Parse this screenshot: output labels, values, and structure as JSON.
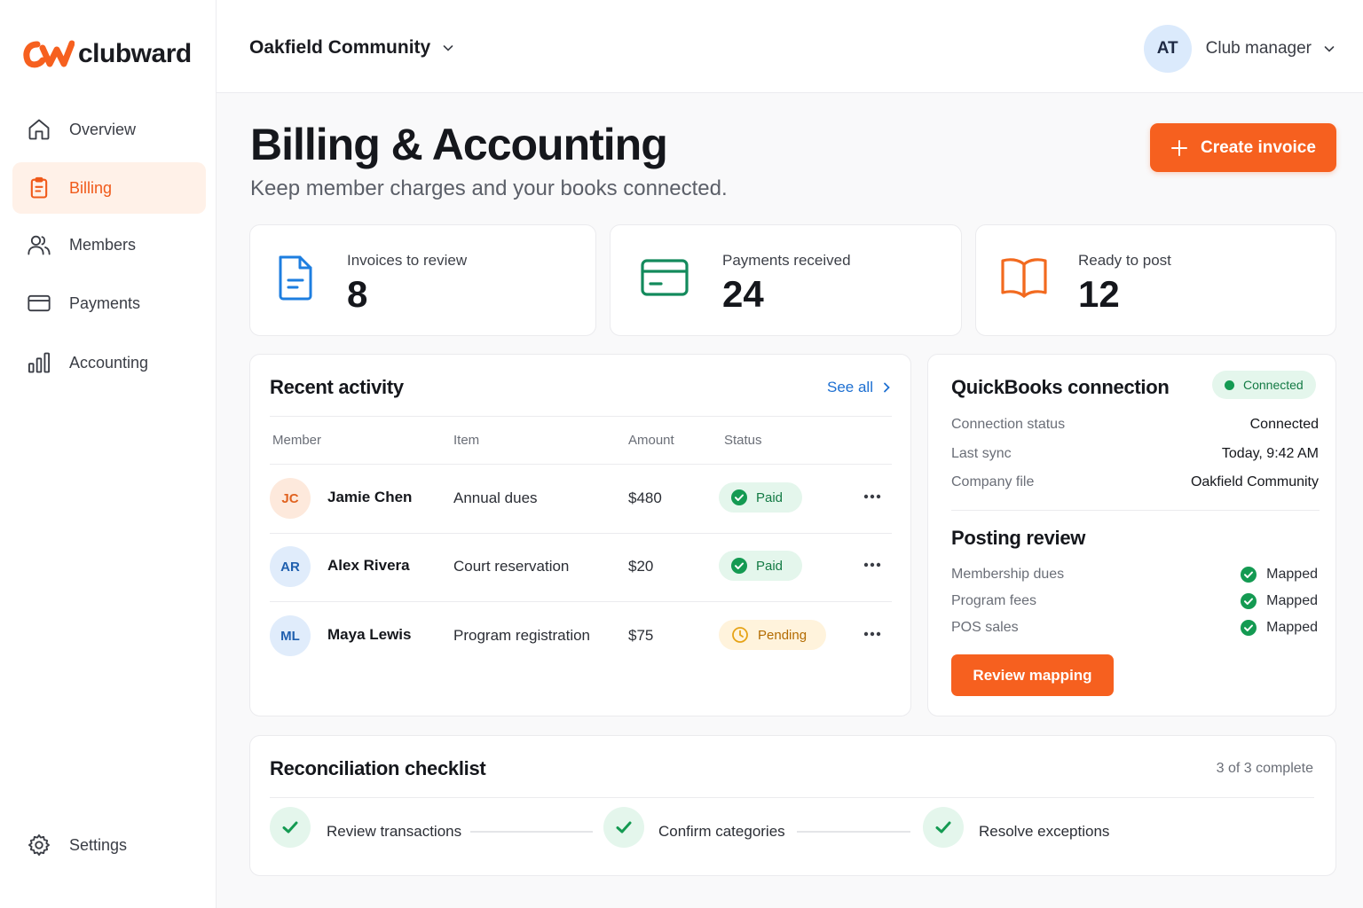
{
  "brand": {
    "name": "clubward",
    "accent": "#f6601f"
  },
  "sidebar": {
    "items": [
      {
        "label": "Overview",
        "icon": "home-icon"
      },
      {
        "label": "Billing",
        "icon": "clipboard-icon",
        "active": true
      },
      {
        "label": "Members",
        "icon": "users-icon"
      },
      {
        "label": "Payments",
        "icon": "credit-card-icon"
      },
      {
        "label": "Accounting",
        "icon": "bar-chart-icon"
      }
    ],
    "settings_label": "Settings"
  },
  "topbar": {
    "org_name": "Oakfield Community",
    "user_initials": "AT",
    "user_role": "Club manager"
  },
  "header": {
    "title": "Billing & Accounting",
    "subtitle": "Keep member charges and your books connected.",
    "create_label": "Create invoice"
  },
  "kpis": [
    {
      "label": "Invoices to review",
      "value": "8",
      "icon": "document-icon",
      "color": "#1d7ee0"
    },
    {
      "label": "Payments received",
      "value": "24",
      "icon": "credit-card-icon",
      "color": "#138a5c"
    },
    {
      "label": "Ready to post",
      "value": "12",
      "icon": "book-open-icon",
      "color": "#f26a1f"
    }
  ],
  "activity": {
    "title": "Recent activity",
    "see_all": "See all",
    "columns": [
      "Member",
      "Item",
      "Amount",
      "Status"
    ],
    "rows": [
      {
        "initials": "JC",
        "member": "Jamie Chen",
        "item": "Annual dues",
        "amount": "$480",
        "status": "Paid"
      },
      {
        "initials": "AR",
        "member": "Alex Rivera",
        "item": "Court reservation",
        "amount": "$20",
        "status": "Paid"
      },
      {
        "initials": "ML",
        "member": "Maya Lewis",
        "item": "Program registration",
        "amount": "$75",
        "status": "Pending"
      }
    ]
  },
  "quickbooks": {
    "title": "QuickBooks connection",
    "badge": "Connected",
    "fields": [
      {
        "label": "Connection status",
        "value": "Connected"
      },
      {
        "label": "Last sync",
        "value": "Today, 9:42 AM"
      },
      {
        "label": "Company file",
        "value": "Oakfield Community"
      }
    ],
    "posting_title": "Posting review",
    "posting": [
      {
        "label": "Membership dues",
        "status": "Mapped"
      },
      {
        "label": "Program fees",
        "status": "Mapped"
      },
      {
        "label": "POS sales",
        "status": "Mapped"
      }
    ],
    "review_label": "Review mapping"
  },
  "reconciliation": {
    "title": "Reconciliation checklist",
    "count": "3 of 3 complete",
    "steps": [
      "Review transactions",
      "Confirm categories",
      "Resolve exceptions"
    ]
  }
}
